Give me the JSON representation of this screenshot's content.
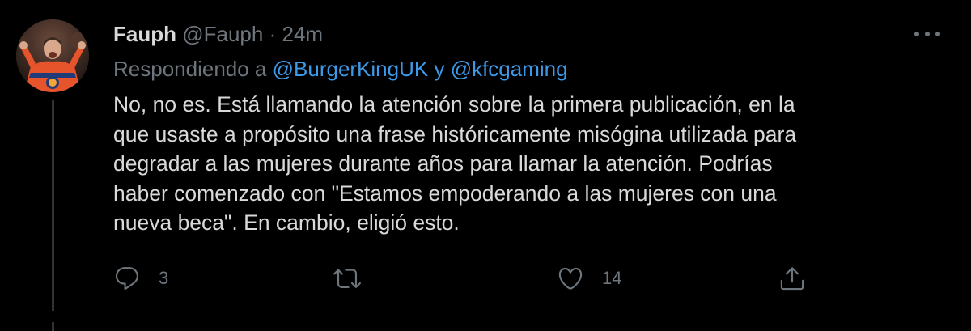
{
  "tweet": {
    "display_name": "Fauph",
    "handle": "@Fauph",
    "separator": "·",
    "time": "24m",
    "replying_prefix": "Respondiendo a",
    "replying_to_1": "@BurgerKingUK",
    "replying_conjunction": "y",
    "replying_to_2": "@kfcgaming",
    "text_lines": [
      "No, no es. Está llamando la atención sobre la primera publicación, en la",
      "que usaste a propósito una frase históricamente misógina utilizada para",
      "degradar a las mujeres durante años para llamar la atención. Podrías",
      "haber comenzado con \"Estamos empoderando a las mujeres con una",
      "nueva beca\". En cambio, eligió esto."
    ],
    "reply_count": "3",
    "retweet_count": "",
    "like_count": "14"
  },
  "icons": {
    "more": "more-horizontal-icon",
    "reply": "reply-bubble-icon",
    "retweet": "retweet-icon",
    "like": "heart-icon",
    "share": "share-upload-icon"
  },
  "colors": {
    "background": "#000000",
    "text": "#d9d9d9",
    "muted": "#6e767d",
    "link": "#3d9ae8",
    "jersey_orange": "#e5542b",
    "jersey_blue": "#1f3b7a"
  }
}
